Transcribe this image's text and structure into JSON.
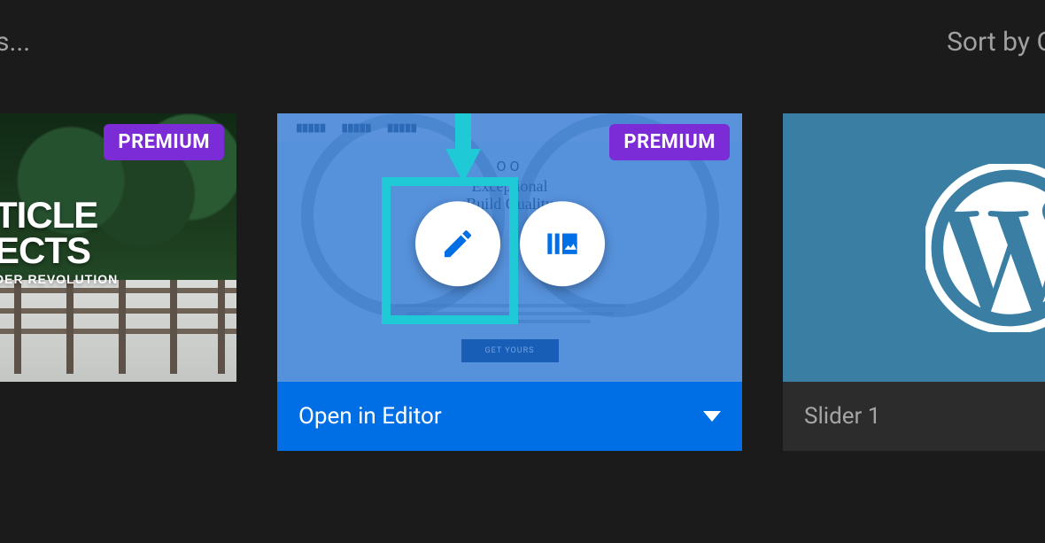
{
  "topbar": {
    "search_fragment": "s...",
    "sort_label": "Sort by C"
  },
  "badges": {
    "premium": "PREMIUM"
  },
  "cards": {
    "card1": {
      "title_line1": "TICLE",
      "title_line2": "ECTS",
      "subtitle": "DER REVOLUTION"
    },
    "card2": {
      "mock_nav": [
        "█████",
        "█████",
        "█████"
      ],
      "infinity": "OO",
      "headline_1": "Exceptional",
      "headline_2": "Build Quality",
      "cta": "GET YOURS",
      "action_label": "Open in Editor"
    },
    "card3": {
      "label": "Slider 1"
    }
  },
  "icons": {
    "edit": "pencil-icon",
    "preview": "slider-image-icon",
    "wordpress": "wordpress-logo-icon"
  },
  "colors": {
    "accent": "#006fe6",
    "highlight": "#1fc9d6",
    "premium": "#7b2cd6",
    "bg": "#1b1b1b"
  }
}
